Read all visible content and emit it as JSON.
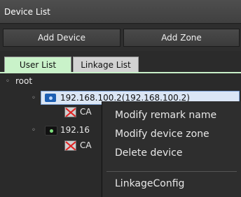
{
  "window": {
    "title": "Device List"
  },
  "toolbar": {
    "add_device": "Add Device",
    "add_zone": "Add Zone"
  },
  "tabs": [
    {
      "label": "User List",
      "active": true
    },
    {
      "label": "Linkage List",
      "active": false
    }
  ],
  "tree": {
    "root_label": "root",
    "devices": [
      {
        "label": "192.168.100.2(192.168.100.2)",
        "selected": true,
        "channel": "CA"
      },
      {
        "label": "192.16",
        "selected": false,
        "channel": "CA"
      }
    ]
  },
  "context_menu": {
    "items": [
      "Modify remark name",
      "Modify device zone",
      "Delete device",
      "LinkageConfig"
    ]
  }
}
